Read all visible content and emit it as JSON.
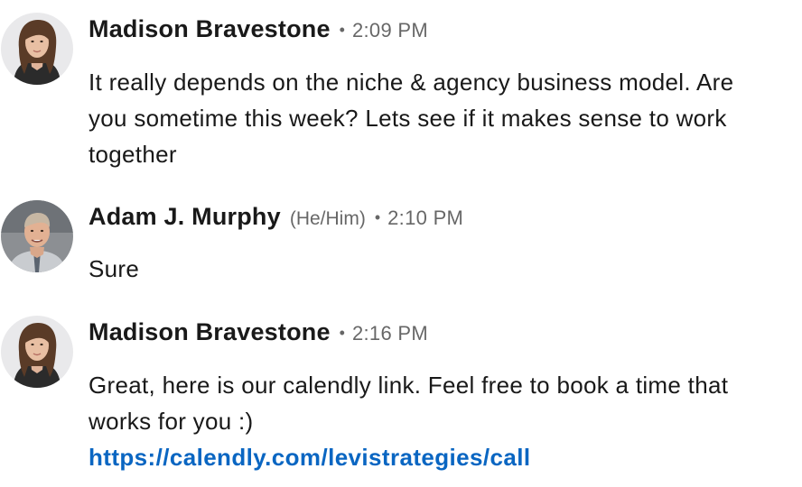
{
  "messages": [
    {
      "sender": "Madison Bravestone",
      "time": "2:09 PM",
      "avatar": "woman-avatar",
      "text": "It really depends on the niche & agency business model. Are you sometime this week? Lets see if it makes sense to work together"
    },
    {
      "sender": "Adam J. Murphy",
      "pronouns": "(He/Him)",
      "time": "2:10 PM",
      "avatar": "man-avatar",
      "text": "Sure"
    },
    {
      "sender": "Madison Bravestone",
      "time": "2:16 PM",
      "avatar": "woman-avatar",
      "text": "Great, here is our calendly link. Feel free to book a time that works for you :)",
      "link": "https://calendly.com/levistrategies/call"
    }
  ],
  "separator": "•",
  "colors": {
    "link": "#0a66c2",
    "meta": "#666666",
    "text": "#1a1a1a"
  }
}
